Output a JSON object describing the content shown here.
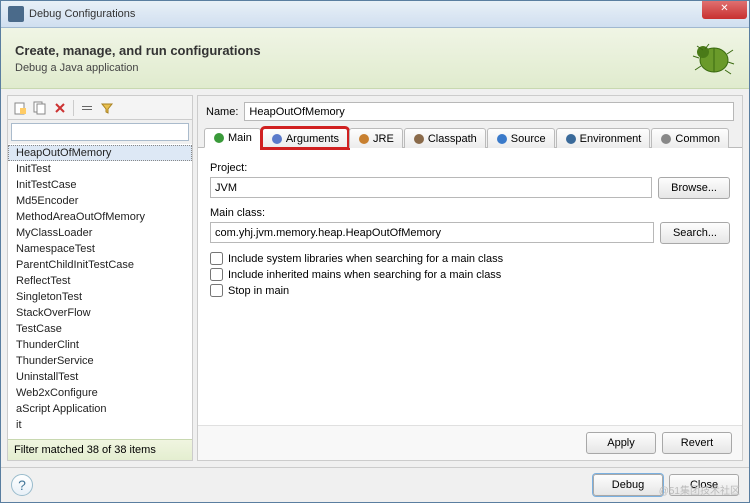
{
  "window": {
    "title": "Debug Configurations"
  },
  "header": {
    "title": "Create, manage, and run configurations",
    "subtitle": "Debug a Java application"
  },
  "filter": {
    "placeholder": "",
    "status": "Filter matched 38 of 38 items"
  },
  "tree": {
    "items": [
      "HeapOutOfMemory",
      "InitTest",
      "InitTestCase",
      "Md5Encoder",
      "MethodAreaOutOfMemory",
      "MyClassLoader",
      "NamespaceTest",
      "ParentChildInitTestCase",
      "ReflectTest",
      "SingletonTest",
      "StackOverFlow",
      "TestCase",
      "ThunderClint",
      "ThunderService",
      "UninstallTest",
      "Web2xConfigure",
      "aScript Application",
      "it"
    ],
    "selected": 0
  },
  "form": {
    "name_label": "Name:",
    "name_value": "HeapOutOfMemory",
    "tabs": [
      "Main",
      "Arguments",
      "JRE",
      "Classpath",
      "Source",
      "Environment",
      "Common"
    ],
    "active_tab": 0,
    "highlight_tab": 1,
    "project_label": "Project:",
    "project_value": "JVM",
    "mainclass_label": "Main class:",
    "mainclass_value": "com.yhj.jvm.memory.heap.HeapOutOfMemory",
    "browse": "Browse...",
    "search": "Search...",
    "cb1": "Include system libraries when searching for a main class",
    "cb2": "Include inherited mains when searching for a main class",
    "cb3": "Stop in main",
    "apply": "Apply",
    "revert": "Revert"
  },
  "footer": {
    "debug": "Debug",
    "close": "Close"
  },
  "watermark": "@51集团技术社区"
}
